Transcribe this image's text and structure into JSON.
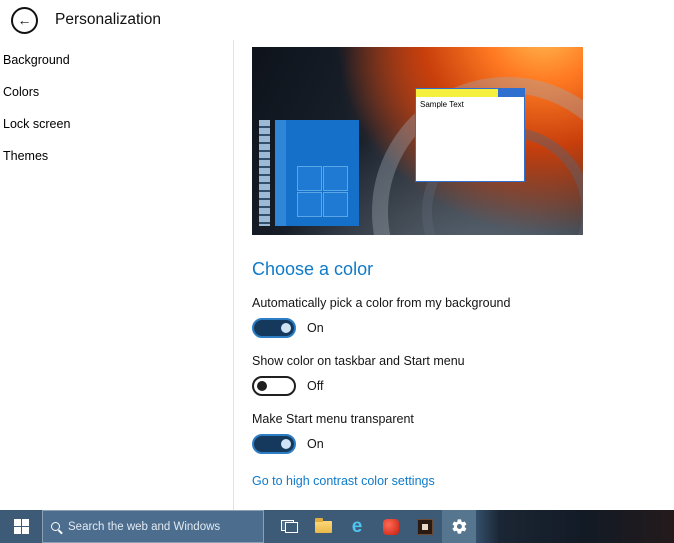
{
  "header": {
    "title": "Personalization",
    "back_glyph": "←"
  },
  "sidebar": {
    "items": [
      {
        "label": "Background"
      },
      {
        "label": "Colors"
      },
      {
        "label": "Lock screen"
      },
      {
        "label": "Themes"
      }
    ]
  },
  "main": {
    "preview": {
      "sample_text": "Sample Text"
    },
    "section_title": "Choose a color",
    "settings": [
      {
        "label": "Automatically pick a color from my background",
        "state": "On",
        "on": true
      },
      {
        "label": "Show color on taskbar and Start menu",
        "state": "Off",
        "on": false
      },
      {
        "label": "Make Start menu transparent",
        "state": "On",
        "on": true
      }
    ],
    "high_contrast_link": "Go to high contrast color settings"
  },
  "taskbar": {
    "search_placeholder": "Search the web and Windows",
    "edge_glyph": "e",
    "icons": {
      "start": "windows-logo-icon",
      "search": "magnifier-icon",
      "task_view": "task-view-icon",
      "file_explorer": "folder-icon",
      "edge": "edge-browser-icon",
      "app_red": "red-app-icon",
      "app_dark": "dark-app-icon",
      "settings": "settings-gear-icon"
    }
  },
  "colors": {
    "accent_blue": "#0f7ac8",
    "taskbar_blue": "#3d5a77",
    "toggle_on_fill": "#15395c",
    "toggle_on_border": "#2d7dc4",
    "preview_titlebar_yellow": "#f5ef3d",
    "preview_start_blue": "#1470c8"
  }
}
